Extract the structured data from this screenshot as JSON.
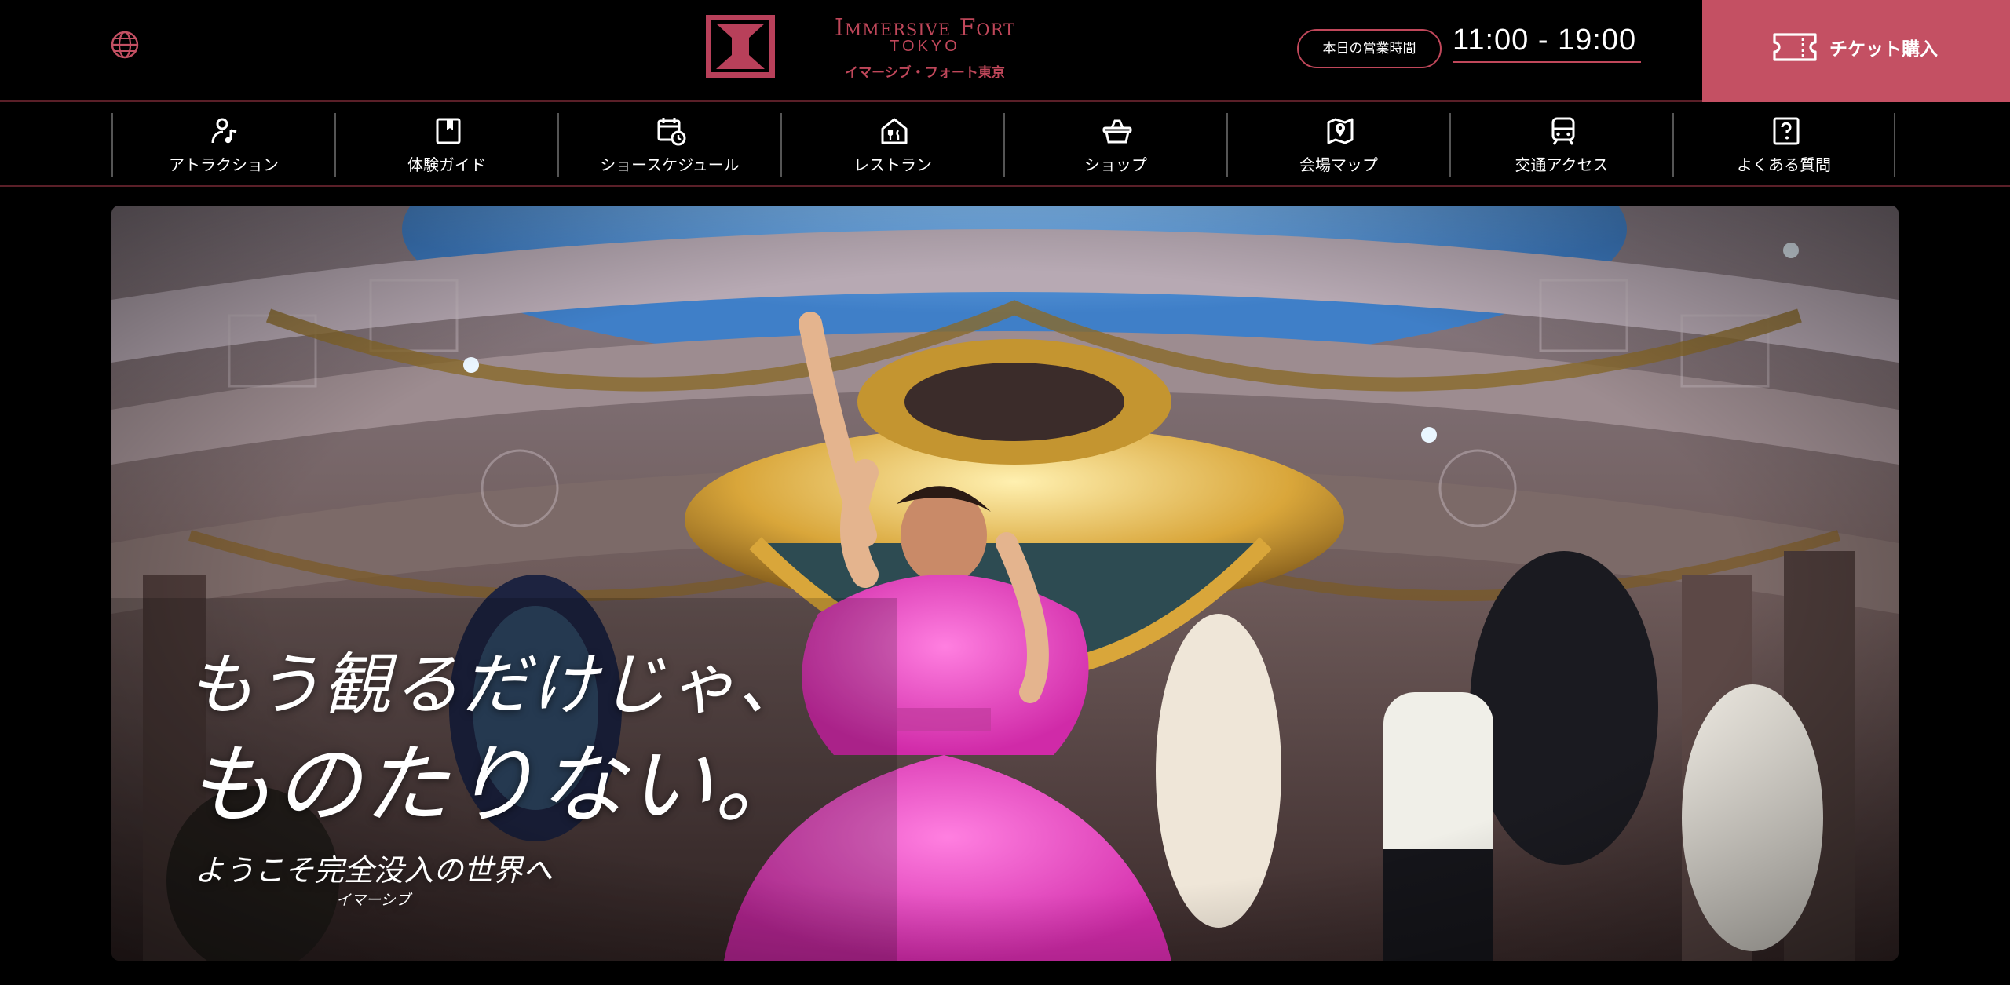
{
  "header": {
    "language_icon": "globe-icon",
    "logo": {
      "name_en": "Immersive Fort",
      "city": "TOKYO",
      "name_ja": "イマーシブ・フォート東京"
    },
    "hours_label": "本日の営業時間",
    "hours_value": "11:00 - 19:00",
    "ticket_label": "チケット購入",
    "ticket_icon": "ticket-icon"
  },
  "nav": {
    "items": [
      {
        "label": "アトラクション",
        "icon": "person-music-icon"
      },
      {
        "label": "体験ガイド",
        "icon": "book-icon"
      },
      {
        "label": "ショースケジュール",
        "icon": "calendar-clock-icon"
      },
      {
        "label": "レストラン",
        "icon": "restaurant-icon"
      },
      {
        "label": "ショップ",
        "icon": "basket-icon"
      },
      {
        "label": "会場マップ",
        "icon": "map-pin-icon"
      },
      {
        "label": "交通アクセス",
        "icon": "train-icon"
      },
      {
        "label": "よくある質問",
        "icon": "question-icon"
      }
    ]
  },
  "hero": {
    "headline_line1": "もう観るだけじゃ、",
    "headline_line2": "ものたりない。",
    "subline": "ようこそ完全没入の世界へ",
    "ruby": "イマーシブ"
  },
  "colors": {
    "accent": "#c45063",
    "accent_text": "#c0475a",
    "background": "#000000"
  }
}
